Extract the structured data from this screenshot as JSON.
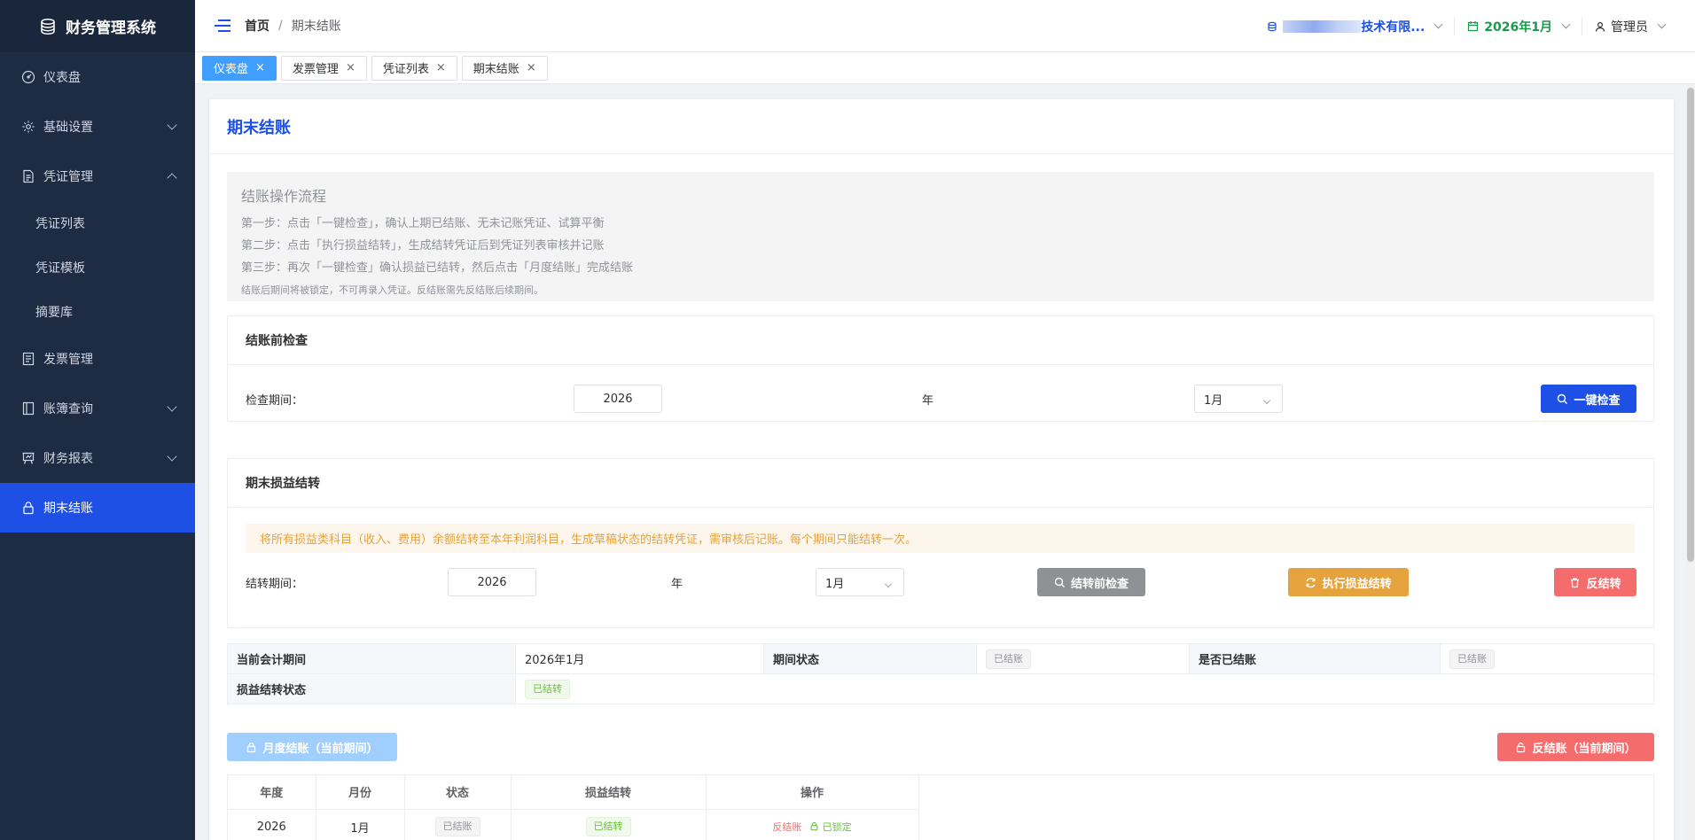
{
  "app": {
    "title": "财务管理系统"
  },
  "sidebar": {
    "items": [
      {
        "label": "仪表盘",
        "icon": "dashboard-icon"
      },
      {
        "label": "基础设置",
        "icon": "gear-icon"
      },
      {
        "label": "凭证管理",
        "icon": "document-icon"
      },
      {
        "label": "凭证列表"
      },
      {
        "label": "凭证模板"
      },
      {
        "label": "摘要库"
      },
      {
        "label": "发票管理",
        "icon": "invoice-icon"
      },
      {
        "label": "账簿查询",
        "icon": "book-icon"
      },
      {
        "label": "财务报表",
        "icon": "chart-board-icon"
      },
      {
        "label": "期末结账",
        "icon": "lock-icon"
      }
    ]
  },
  "topbar": {
    "breadcrumb": {
      "home": "首页",
      "sep": "/",
      "current": "期末结账"
    },
    "company": "技术有限...",
    "period": "2026年1月",
    "user": "管理员"
  },
  "tabs": [
    {
      "label": "仪表盘",
      "close": "×"
    },
    {
      "label": "发票管理",
      "close": "×"
    },
    {
      "label": "凭证列表",
      "close": "×"
    },
    {
      "label": "期末结账",
      "close": "×"
    }
  ],
  "card": {
    "title": "期末结账",
    "process": {
      "title": "结账操作流程",
      "step1": "第一步：点击「一键检查」，确认上期已结账、无未记账凭证、试算平衡",
      "step2": "第二步：点击「执行损益结转」，生成结转凭证后到凭证列表审核并记账",
      "step3": "第三步：再次「一键检查」确认损益已结转，然后点击「月度结账」完成结账",
      "note": "结账后期间将被锁定，不可再录入凭证。反结账需先反结账后续期间。"
    },
    "precheck": {
      "title": "结账前检查",
      "label": "检查期间：",
      "year": "2026",
      "year_unit": "年",
      "month": "1月",
      "button": "一键检查"
    },
    "carryover": {
      "title": "期末损益结转",
      "alert": "将所有损益类科目（收入、费用）余额结转至本年利润科目，生成草稿状态的结转凭证，需审核后记账。每个期间只能结转一次。",
      "label": "结转期间：",
      "year": "2026",
      "year_unit": "年",
      "month": "1月",
      "btn_check": "结转前检查",
      "btn_execute": "执行损益结转",
      "btn_reverse": "反结转"
    },
    "status": {
      "k1": "当前会计期间",
      "v1": "2026年1月",
      "k2": "期间状态",
      "v2": "已结账",
      "k3": "是否已结账",
      "v3": "已结账",
      "k4": "损益结转状态",
      "v4": "已结转"
    },
    "actions": {
      "close_month": "月度结账（当前期间）",
      "reopen_month": "反结账（当前期间）"
    },
    "periods": {
      "headers": [
        "年度",
        "月份",
        "状态",
        "损益结转",
        "操作"
      ],
      "rows": [
        {
          "year": "2026",
          "month": "1月",
          "status": "已结账",
          "carry": "已结转",
          "op_reopen": "反结账",
          "op_locked": "已锁定"
        }
      ]
    }
  },
  "colors": {
    "primary": "#1e50e6",
    "sidebar": "#1d2b43",
    "success": "#67c23a",
    "warning": "#e6a23c",
    "danger": "#f56c6c"
  }
}
